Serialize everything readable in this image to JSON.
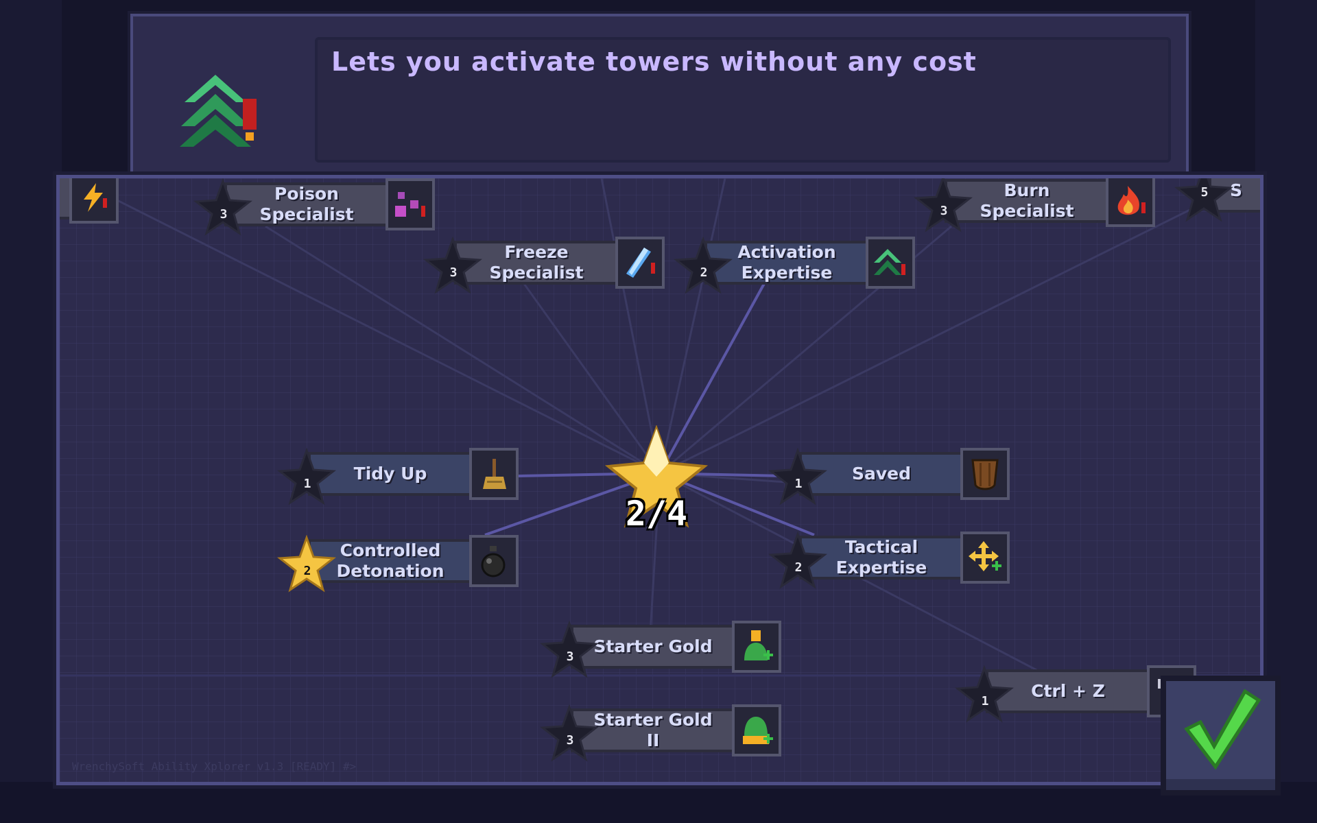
{
  "description": {
    "text": "Lets you activate towers without any cost",
    "icon": "activation-chevron-icon"
  },
  "center": {
    "count": "2/4"
  },
  "skills": [
    {
      "id": "lightning",
      "label": "",
      "cost": "",
      "icon": "lightning-icon",
      "partial": true
    },
    {
      "id": "poison",
      "label1": "Poison",
      "label2": "Specialist",
      "cost": "3",
      "icon": "poison-icon"
    },
    {
      "id": "freeze",
      "label1": "Freeze",
      "label2": "Specialist",
      "cost": "3",
      "icon": "freeze-icon"
    },
    {
      "id": "activation",
      "label1": "Activation",
      "label2": "Expertise",
      "cost": "2",
      "icon": "activation-chevron-icon"
    },
    {
      "id": "burn",
      "label1": "Burn",
      "label2": "Specialist",
      "cost": "3",
      "icon": "fire-icon"
    },
    {
      "id": "partial-right",
      "label": "S",
      "cost": "5",
      "partial": true
    },
    {
      "id": "tidy",
      "label1": "Tidy Up",
      "label2": "",
      "cost": "1",
      "icon": "broom-icon"
    },
    {
      "id": "saved",
      "label1": "Saved",
      "label2": "",
      "cost": "1",
      "icon": "shield-icon"
    },
    {
      "id": "detonation",
      "label1": "Controlled",
      "label2": "Detonation",
      "cost": "2",
      "icon": "bomb-icon",
      "selected": true
    },
    {
      "id": "tactical",
      "label1": "Tactical",
      "label2": "Expertise",
      "cost": "2",
      "icon": "move-arrows-icon"
    },
    {
      "id": "gold1",
      "label1": "Starter Gold",
      "label2": "",
      "cost": "3",
      "icon": "gold-slime-icon"
    },
    {
      "id": "gold2",
      "label1": "Starter Gold",
      "label2": "II",
      "cost": "3",
      "icon": "gold-slime-icon"
    },
    {
      "id": "ctrlz",
      "label1": "Ctrl + Z",
      "label2": "",
      "cost": "1",
      "icon": "hammer-icon"
    }
  ],
  "footer": {
    "version": "WrenchySoft Ability Xplorer v1.3 [READY] #>"
  },
  "confirm": {
    "icon": "checkmark-icon"
  },
  "colors": {
    "accent": "#c9b8ff",
    "board": "#2d2b4d",
    "star_gold": "#f5c542",
    "check_green": "#55d84a"
  }
}
